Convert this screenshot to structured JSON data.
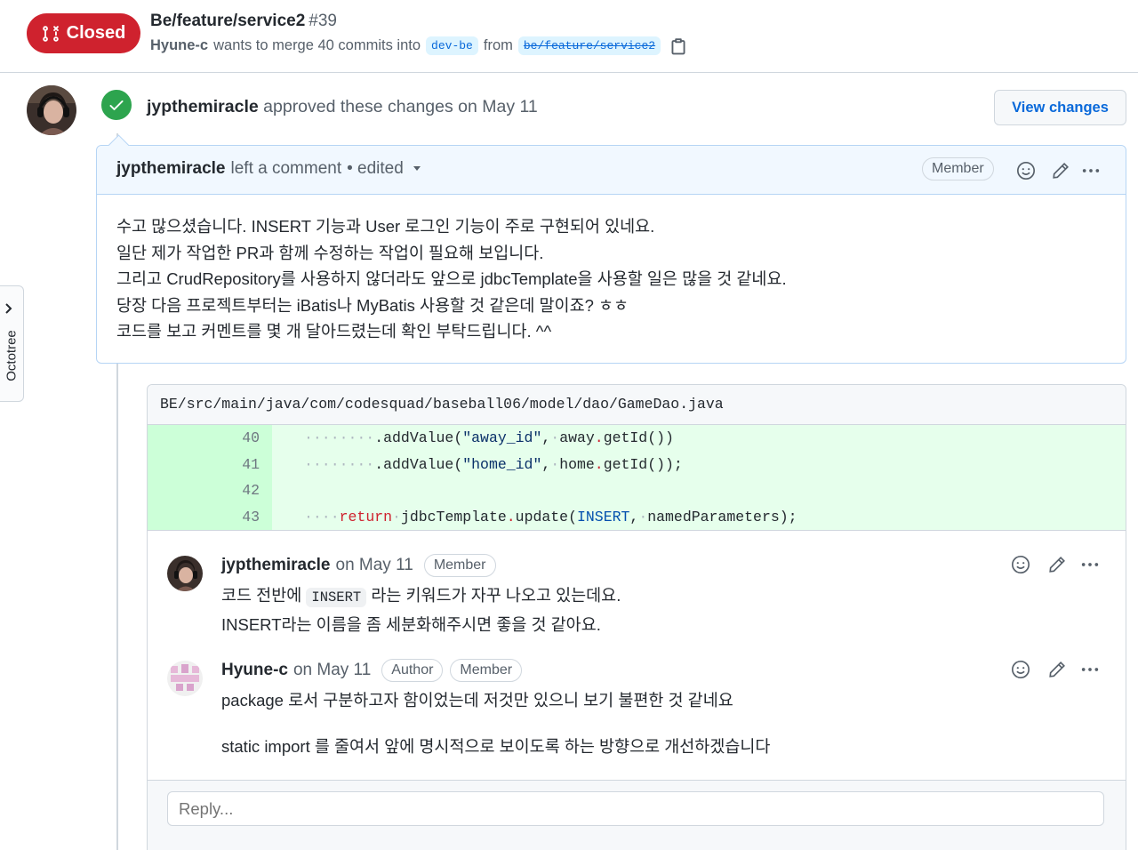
{
  "pr": {
    "state": "Closed",
    "title": "Be/feature/service2",
    "number": "#39",
    "author": "Hyune-c",
    "merge_text": "wants to merge 40 commits into",
    "base_branch": "dev-be",
    "from_text": "from",
    "head_branch": "be/feature/service2"
  },
  "octotree": {
    "label": "Octotree"
  },
  "review": {
    "user": "jypthemiracle",
    "action": "approved these changes",
    "date": "on May 11",
    "view_changes": "View changes",
    "comment_header": {
      "user": "jypthemiracle",
      "action": "left a comment",
      "edited": "• edited",
      "badge": "Member"
    },
    "body": [
      "수고 많으셨습니다. INSERT 기능과 User 로그인 기능이 주로 구현되어 있네요.",
      "일단 제가 작업한 PR과 함께 수정하는 작업이 필요해 보입니다.",
      "그리고 CrudRepository를 사용하지 않더라도 앞으로 jdbcTemplate을 사용할 일은 많을 것 같네요.",
      "당장 다음 프로젝트부터는 iBatis나 MyBatis 사용할 것 같은데 말이죠? ㅎㅎ",
      "코드를 보고 커멘트를 몇 개 달아드렸는데 확인 부탁드립니다. ^^"
    ]
  },
  "thread": {
    "file_path": "BE/src/main/java/com/codesquad/baseball06/model/dao/GameDao.java",
    "lines": [
      {
        "num": "40",
        "indent": "········",
        "text": ".addValue(\"away_id\",·away.getId())"
      },
      {
        "num": "41",
        "indent": "········",
        "text": ".addValue(\"home_id\",·home.getId());"
      },
      {
        "num": "42",
        "indent": "",
        "text": ""
      },
      {
        "num": "43",
        "indent": "····",
        "text": "return·jdbcTemplate.update(INSERT,·namedParameters);"
      }
    ],
    "code_segments": {
      "l40": {
        "call": ".addValue(",
        "str": "\"away_id\"",
        "comma": ",",
        "sp": "·",
        "obj": "away",
        "dot": ".",
        "rest": "getId())"
      },
      "l41": {
        "call": ".addValue(",
        "str": "\"home_id\"",
        "comma": ",",
        "sp": "·",
        "obj": "home",
        "dot": ".",
        "rest": "getId());"
      },
      "l43": {
        "kw": "return",
        "sp": "·",
        "obj": "jdbcTemplate",
        "dot": ".",
        "call": "update(",
        "const": "INSERT",
        "comma": ",",
        "sp2": "·",
        "rest": "namedParameters);"
      }
    },
    "comments": [
      {
        "user": "jypthemiracle",
        "date": "on May 11",
        "badges": [
          "Member"
        ],
        "line1_before": "코드 전반에",
        "line1_code": "INSERT",
        "line1_after": "라는 키워드가 자꾸 나오고 있는데요.",
        "line2": "INSERT라는 이름을 좀 세분화해주시면 좋을 것 같아요."
      },
      {
        "user": "Hyune-c",
        "date": "on May 11",
        "badges": [
          "Author",
          "Member"
        ],
        "line1": "package 로서 구분하고자 함이었는데 저것만 있으니 보기 불편한 것 같네요",
        "line2": "static import 를 줄여서 앞에 명시적으로 보이도록 하는 방향으로 개선하겠습니다"
      }
    ],
    "reply_placeholder": "Reply..."
  },
  "icons": {
    "state": "git-pull-request-closed-icon",
    "copy": "copy-icon",
    "approve": "check-icon",
    "emoji": "smiley-icon",
    "edit": "pencil-icon",
    "more": "kebab-horizontal-icon",
    "caret": "triangle-down-icon",
    "octotree_chevron": "chevron-right-icon"
  },
  "colors": {
    "closed": "#cf222e",
    "approved": "#2da44e",
    "link": "#0969da",
    "addition_bg": "#e6ffec",
    "addition_num_bg": "#ccffd8"
  }
}
